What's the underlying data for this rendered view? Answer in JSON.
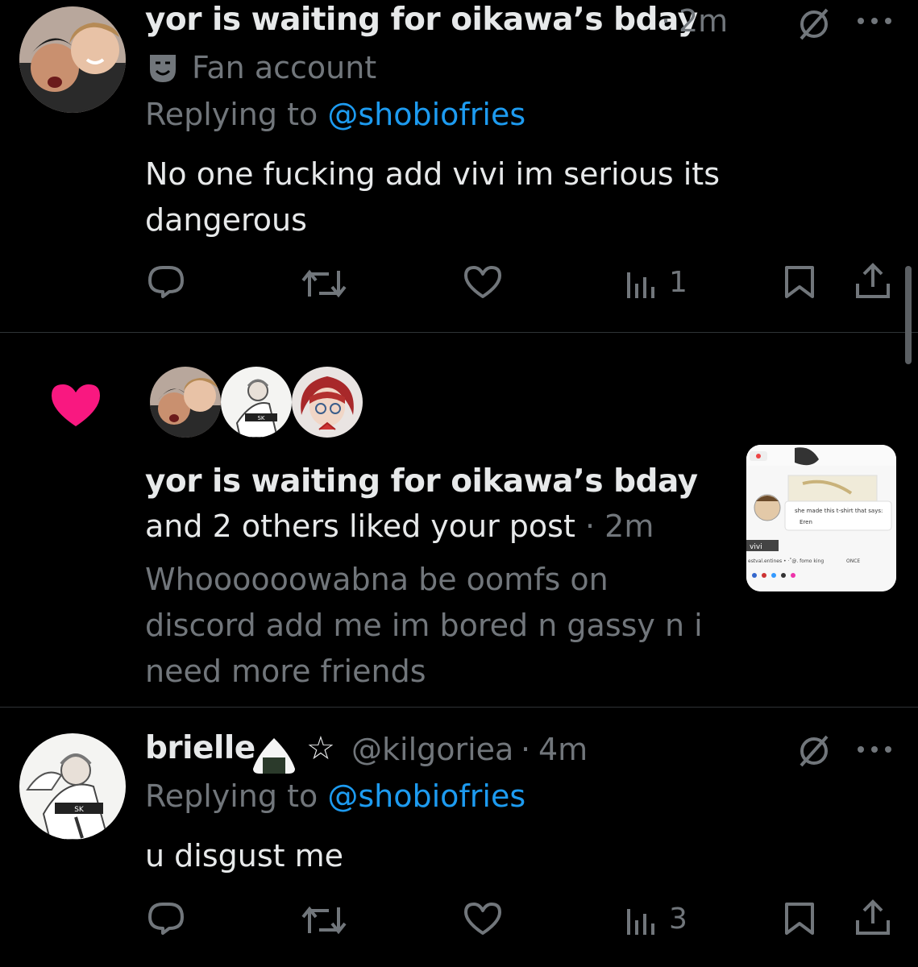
{
  "tweet1": {
    "display_name": "yor is waiting for oikawa’s bday",
    "sep": "·",
    "time": "2m",
    "label_text": "Fan account",
    "replying_prefix": "Replying to",
    "replying_handle": "@shobiofries",
    "text_line1": "No one fucking add vivi im serious its",
    "text_line2": "dangerous",
    "views": "1",
    "label_icon": "theater-mask-icon"
  },
  "notification": {
    "icon": "heart-icon",
    "heart_color": "#f91880",
    "name": "yor is waiting for oikawa’s bday",
    "action": "and 2 others liked your post",
    "sep": "·",
    "time": "2m",
    "post_line1": "Whoooooowabna be oomfs on",
    "post_line2": "discord add me im bored n gassy n i",
    "post_line3": "need more friends",
    "thumb_caption": "she made this t-shirt that says:",
    "thumb_sub": "Eren",
    "thumb_user": "vivi",
    "thumb_row": "estval.entines • ·˚@. fomo king",
    "thumb_badge": "ONCE"
  },
  "tweet2": {
    "display_name": "brielle",
    "emoji_star": "☆",
    "handle": "@kilgoriea",
    "sep": "·",
    "time": "4m",
    "replying_prefix": "Replying to",
    "replying_handle": "@shobiofries",
    "text": "u disgust me",
    "views": "3"
  },
  "colors": {
    "background": "#000000",
    "text": "#e7e9ea",
    "muted": "#71767b",
    "link": "#1d9bf0",
    "like_pink": "#f91880"
  }
}
